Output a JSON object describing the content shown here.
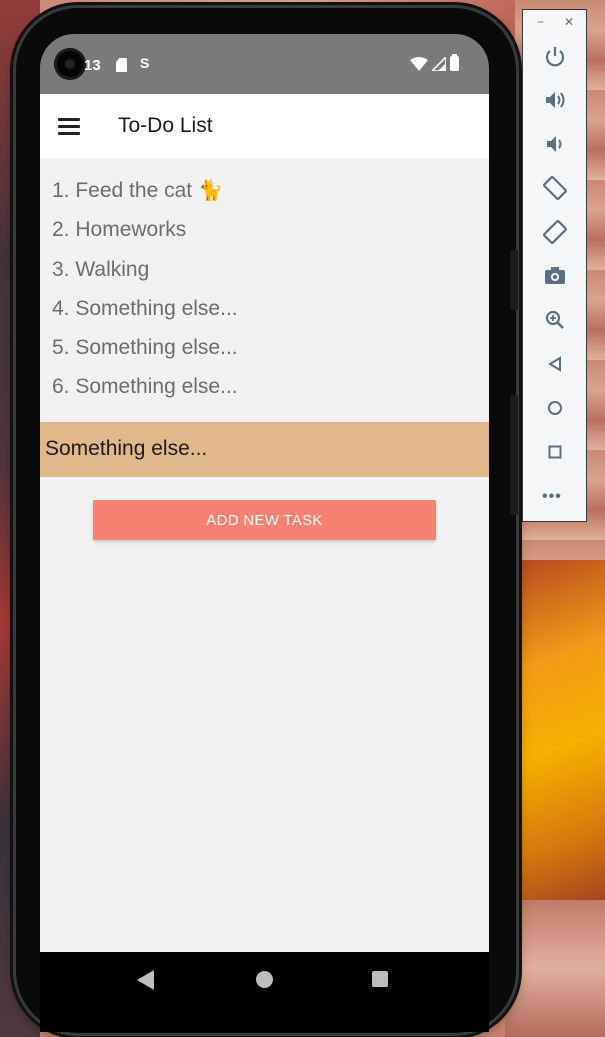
{
  "status_bar": {
    "time": "13",
    "sim_icon": "sd-card-icon",
    "s_icon": "S",
    "right_icons": [
      "wifi-icon",
      "signal-icon",
      "battery-icon"
    ]
  },
  "app_bar": {
    "title": "To-Do List",
    "menu_icon": "menu-icon"
  },
  "tasks": [
    {
      "number": "1.",
      "text": "Feed the cat",
      "emoji": "🐈"
    },
    {
      "number": "2.",
      "text": "Homeworks"
    },
    {
      "number": "3.",
      "text": "Walking"
    },
    {
      "number": "4.",
      "text": "Something else..."
    },
    {
      "number": "5.",
      "text": "Something else..."
    },
    {
      "number": "6.",
      "text": "Something else..."
    }
  ],
  "selected_task": {
    "text": "Something else..."
  },
  "add_button": {
    "label": "ADD NEW TASK"
  },
  "nav_bar": {
    "back": "back-icon",
    "home": "home-icon",
    "recents": "recents-icon"
  },
  "emulator_toolbar": {
    "window_controls": {
      "minimize": "−",
      "close": "✕"
    },
    "buttons": [
      "power-icon",
      "volume-up-icon",
      "volume-down-icon",
      "rotate-left-icon",
      "rotate-right-icon",
      "camera-icon",
      "zoom-icon",
      "back-icon",
      "home-icon",
      "overview-icon"
    ],
    "more": "•••"
  },
  "colors": {
    "status_bar": "#7a7a7a",
    "app_bar": "#ffffff",
    "content_bg": "#f1f1f1",
    "selected_bar": "#dfb98a",
    "add_button": "#f7806e",
    "toolbar_icon": "#5b6f82"
  }
}
